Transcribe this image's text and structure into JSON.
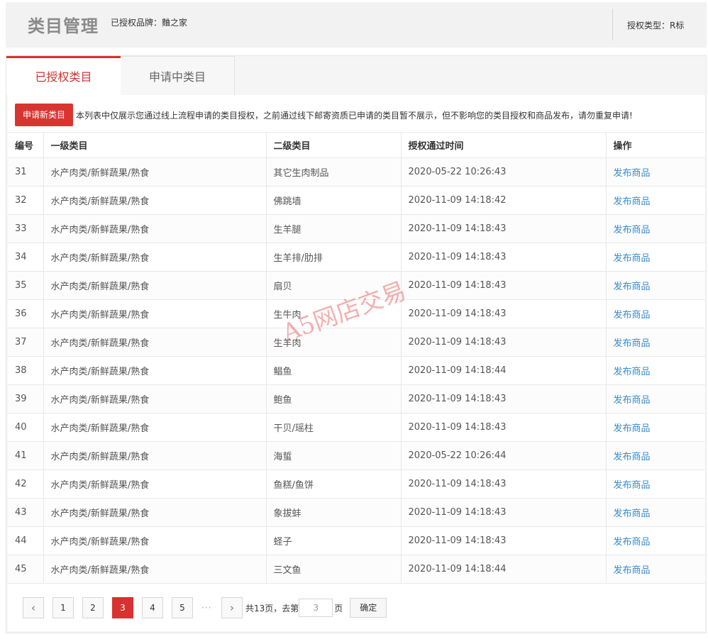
{
  "header": {
    "title": "类目管理",
    "brand_line": "已授权品牌：麯之家",
    "auth_type_line": "授权类型：R标"
  },
  "tabs": [
    {
      "label": "已授权类目",
      "active": true
    },
    {
      "label": "申请中类目",
      "active": false
    }
  ],
  "notice": {
    "apply_button": "申请新类目",
    "text": "本列表中仅展示您通过线上流程申请的类目授权，之前通过线下邮寄资质已申请的类目暂不展示，但不影响您的类目授权和商品发布，请勿重复申请!"
  },
  "table": {
    "columns": [
      "编号",
      "一级类目",
      "二级类目",
      "授权通过时间",
      "操作"
    ],
    "action_label": "发布商品",
    "rows": [
      {
        "id": "31",
        "level1": "水产肉类/新鲜蔬果/熟食",
        "level2": "其它生肉制品",
        "time": "2020-05-22 10:26:43"
      },
      {
        "id": "32",
        "level1": "水产肉类/新鲜蔬果/熟食",
        "level2": "佛跳墙",
        "time": "2020-11-09 14:18:42"
      },
      {
        "id": "33",
        "level1": "水产肉类/新鲜蔬果/熟食",
        "level2": "生羊腿",
        "time": "2020-11-09 14:18:43"
      },
      {
        "id": "34",
        "level1": "水产肉类/新鲜蔬果/熟食",
        "level2": "生羊排/肋排",
        "time": "2020-11-09 14:18:43"
      },
      {
        "id": "35",
        "level1": "水产肉类/新鲜蔬果/熟食",
        "level2": "扇贝",
        "time": "2020-11-09 14:18:43"
      },
      {
        "id": "36",
        "level1": "水产肉类/新鲜蔬果/熟食",
        "level2": "生牛肉",
        "time": "2020-11-09 14:18:43"
      },
      {
        "id": "37",
        "level1": "水产肉类/新鲜蔬果/熟食",
        "level2": "生羊肉",
        "time": "2020-11-09 14:18:43"
      },
      {
        "id": "38",
        "level1": "水产肉类/新鲜蔬果/熟食",
        "level2": "鲳鱼",
        "time": "2020-11-09 14:18:44"
      },
      {
        "id": "39",
        "level1": "水产肉类/新鲜蔬果/熟食",
        "level2": "鲍鱼",
        "time": "2020-11-09 14:18:43"
      },
      {
        "id": "40",
        "level1": "水产肉类/新鲜蔬果/熟食",
        "level2": "干贝/瑶柱",
        "time": "2020-11-09 14:18:43"
      },
      {
        "id": "41",
        "level1": "水产肉类/新鲜蔬果/熟食",
        "level2": "海蜇",
        "time": "2020-05-22 10:26:44"
      },
      {
        "id": "42",
        "level1": "水产肉类/新鲜蔬果/熟食",
        "level2": "鱼糕/鱼饼",
        "time": "2020-11-09 14:18:43"
      },
      {
        "id": "43",
        "level1": "水产肉类/新鲜蔬果/熟食",
        "level2": "象拔蚌",
        "time": "2020-11-09 14:18:43"
      },
      {
        "id": "44",
        "level1": "水产肉类/新鲜蔬果/熟食",
        "level2": "蛏子",
        "time": "2020-11-09 14:18:43"
      },
      {
        "id": "45",
        "level1": "水产肉类/新鲜蔬果/熟食",
        "level2": "三文鱼",
        "time": "2020-11-09 14:18:44"
      }
    ]
  },
  "pagination": {
    "prev_icon": "chevron-left-icon",
    "next_icon": "chevron-right-icon",
    "pages": [
      "1",
      "2",
      "3",
      "4",
      "5"
    ],
    "current": "3",
    "ellipsis": "···",
    "total_text": "共13页，去第",
    "input_value": "3",
    "unit": "页",
    "confirm_label": "确定"
  },
  "watermark": "A5网店交易",
  "colors": {
    "accent_red": "#d9312f",
    "link_blue": "#3a8ac8",
    "title_gray": "#8a8a8a"
  }
}
